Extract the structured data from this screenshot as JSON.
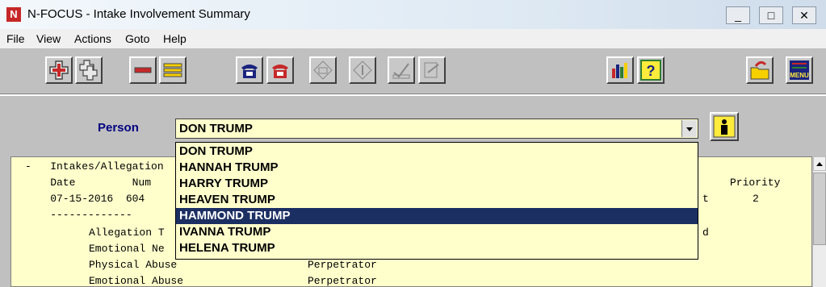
{
  "window": {
    "title": "N-FOCUS - Intake Involvement Summary",
    "icon_letter": "N"
  },
  "window_buttons": [
    "_",
    "□",
    "✕"
  ],
  "menu": [
    "File",
    "View",
    "Actions",
    "Goto",
    "Help"
  ],
  "toolbar_icons": [
    "add-icon",
    "add-multiple-icon",
    "remove-icon",
    "list-icon",
    "phone-blue-icon",
    "phone-red-icon",
    "phone-disabled-icon",
    "info-disabled-icon",
    "approve-disabled-icon",
    "edit-disabled-icon",
    "chart-icon",
    "help-icon",
    "exit-folder-icon",
    "menu-icon"
  ],
  "menu_button_label": "MENU",
  "person": {
    "label": "Person",
    "value": "DON TRUMP"
  },
  "dropdown_options": [
    "DON TRUMP",
    "HANNAH TRUMP",
    "HARRY TRUMP",
    "HEAVEN TRUMP",
    "HAMMOND TRUMP",
    "IVANNA TRUMP",
    "HELENA TRUMP"
  ],
  "selected_index": 4,
  "summary": {
    "section": "-   Intakes/Allegation",
    "header_left": "    Date         Num",
    "priority_label": "Priority",
    "row_left": "    07-15-2016  604",
    "row_right_t": "t",
    "priority_value": "2",
    "divider": "    -------------",
    "rows": [
      {
        "allegation": "Allegation T",
        "role": "",
        "trail": "d"
      },
      {
        "allegation": "Emotional Ne",
        "role": "",
        "trail": ""
      },
      {
        "allegation": "Physical Abuse",
        "role": "Perpetrator",
        "trail": ""
      },
      {
        "allegation": "Emotional Abuse",
        "role": "Perpetrator",
        "trail": ""
      }
    ]
  }
}
